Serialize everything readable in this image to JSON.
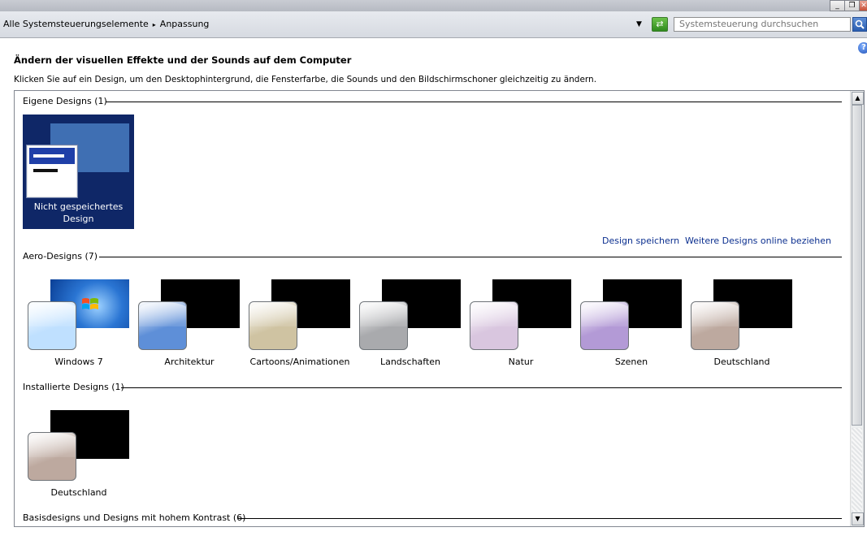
{
  "window": {
    "minimize": "_",
    "maximize": "❐",
    "close": "✕"
  },
  "address": {
    "crumb1": "Alle Systemsteuerungselemente",
    "crumb_sep": "▸",
    "crumb2": "Anpassung",
    "search_placeholder": "Systemsteuerung durchsuchen"
  },
  "header": {
    "title": "Ändern der visuellen Effekte und der Sounds auf dem Computer",
    "description": "Klicken Sie auf ein Design, um den Desktophintergrund, die Fensterfarbe, die Sounds und den Bildschirmschoner gleichzeitig zu ändern."
  },
  "sections": {
    "own": "Eigene Designs (1)",
    "aero": "Aero-Designs (7)",
    "installed": "Installierte Designs (1)",
    "basic": "Basisdesigns und Designs mit hohem Kontrast (6)"
  },
  "unsaved_design": {
    "line1": "Nicht gespeichertes",
    "line2": "Design"
  },
  "links": {
    "save": "Design speichern",
    "more": "Weitere Designs online beziehen"
  },
  "aero_themes": [
    {
      "name": "Windows 7",
      "color": "#bfe0ff"
    },
    {
      "name": "Architektur",
      "color": "#5e8fd8"
    },
    {
      "name": "Cartoons/Animationen",
      "color": "#cfc3a2"
    },
    {
      "name": "Landschaften",
      "color": "#a9aaad"
    },
    {
      "name": "Natur",
      "color": "#d9c6df"
    },
    {
      "name": "Szenen",
      "color": "#b39ad6"
    },
    {
      "name": "Deutschland",
      "color": "#bda99f"
    }
  ],
  "installed_themes": [
    {
      "name": "Deutschland",
      "color": "#bda99f"
    }
  ],
  "icons": [
    "minimize-icon",
    "maximize-icon",
    "close-icon",
    "dropdown-icon",
    "refresh-icon",
    "search-icon",
    "help-icon",
    "scroll-up-icon",
    "scroll-down-icon",
    "windows-logo-icon"
  ]
}
